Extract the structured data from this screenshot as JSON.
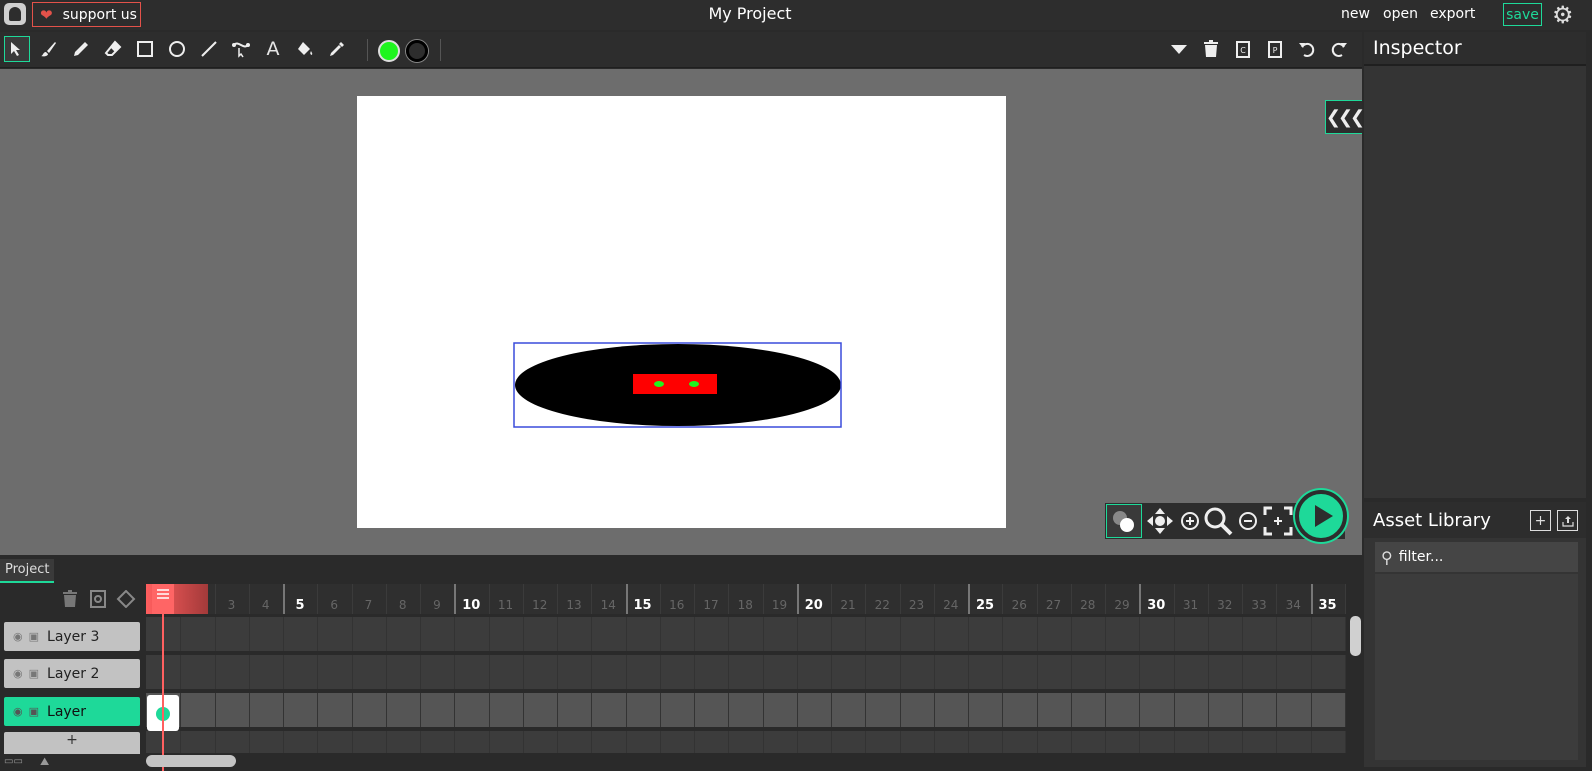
{
  "topbar": {
    "support_label": "support us",
    "project_title": "My Project",
    "menu": [
      "new",
      "open",
      "export"
    ],
    "save_label": "save"
  },
  "toolbar": {
    "tools": [
      "cursor-icon",
      "brush-icon",
      "pencil-icon",
      "eraser-icon",
      "rectangle-icon",
      "ellipse-icon",
      "line-icon",
      "path-icon",
      "text-icon",
      "fill-bucket-icon",
      "eyedropper-icon"
    ],
    "active_tool": "cursor-icon",
    "fill_color": "#1ef51e",
    "stroke_color": "#000000",
    "right_actions": [
      "dropdown-icon",
      "trash-icon",
      "copy-icon",
      "paste-icon",
      "undo-icon",
      "redo-icon"
    ]
  },
  "inspector": {
    "title": "Inspector"
  },
  "asset_library": {
    "title": "Asset Library",
    "filter_placeholder": "filter..."
  },
  "timeline": {
    "tab_label": "Project",
    "frame_numbers": [
      "3",
      "4",
      "5",
      "6",
      "7",
      "8",
      "9",
      "10",
      "11",
      "12",
      "13",
      "14",
      "15",
      "16",
      "17",
      "18",
      "19",
      "20",
      "21",
      "22",
      "23",
      "24",
      "25",
      "26",
      "27",
      "28",
      "29",
      "30",
      "31",
      "32",
      "33",
      "34",
      "35",
      "3"
    ],
    "layers": [
      {
        "name": "Layer 3",
        "active": false
      },
      {
        "name": "Layer 2",
        "active": false
      },
      {
        "name": "Layer",
        "active": true
      }
    ],
    "add_layer_label": "+",
    "current_frame": 1
  },
  "colors": {
    "accent": "#1ed999",
    "playhead": "#ff6060",
    "support": "#e3524a"
  }
}
